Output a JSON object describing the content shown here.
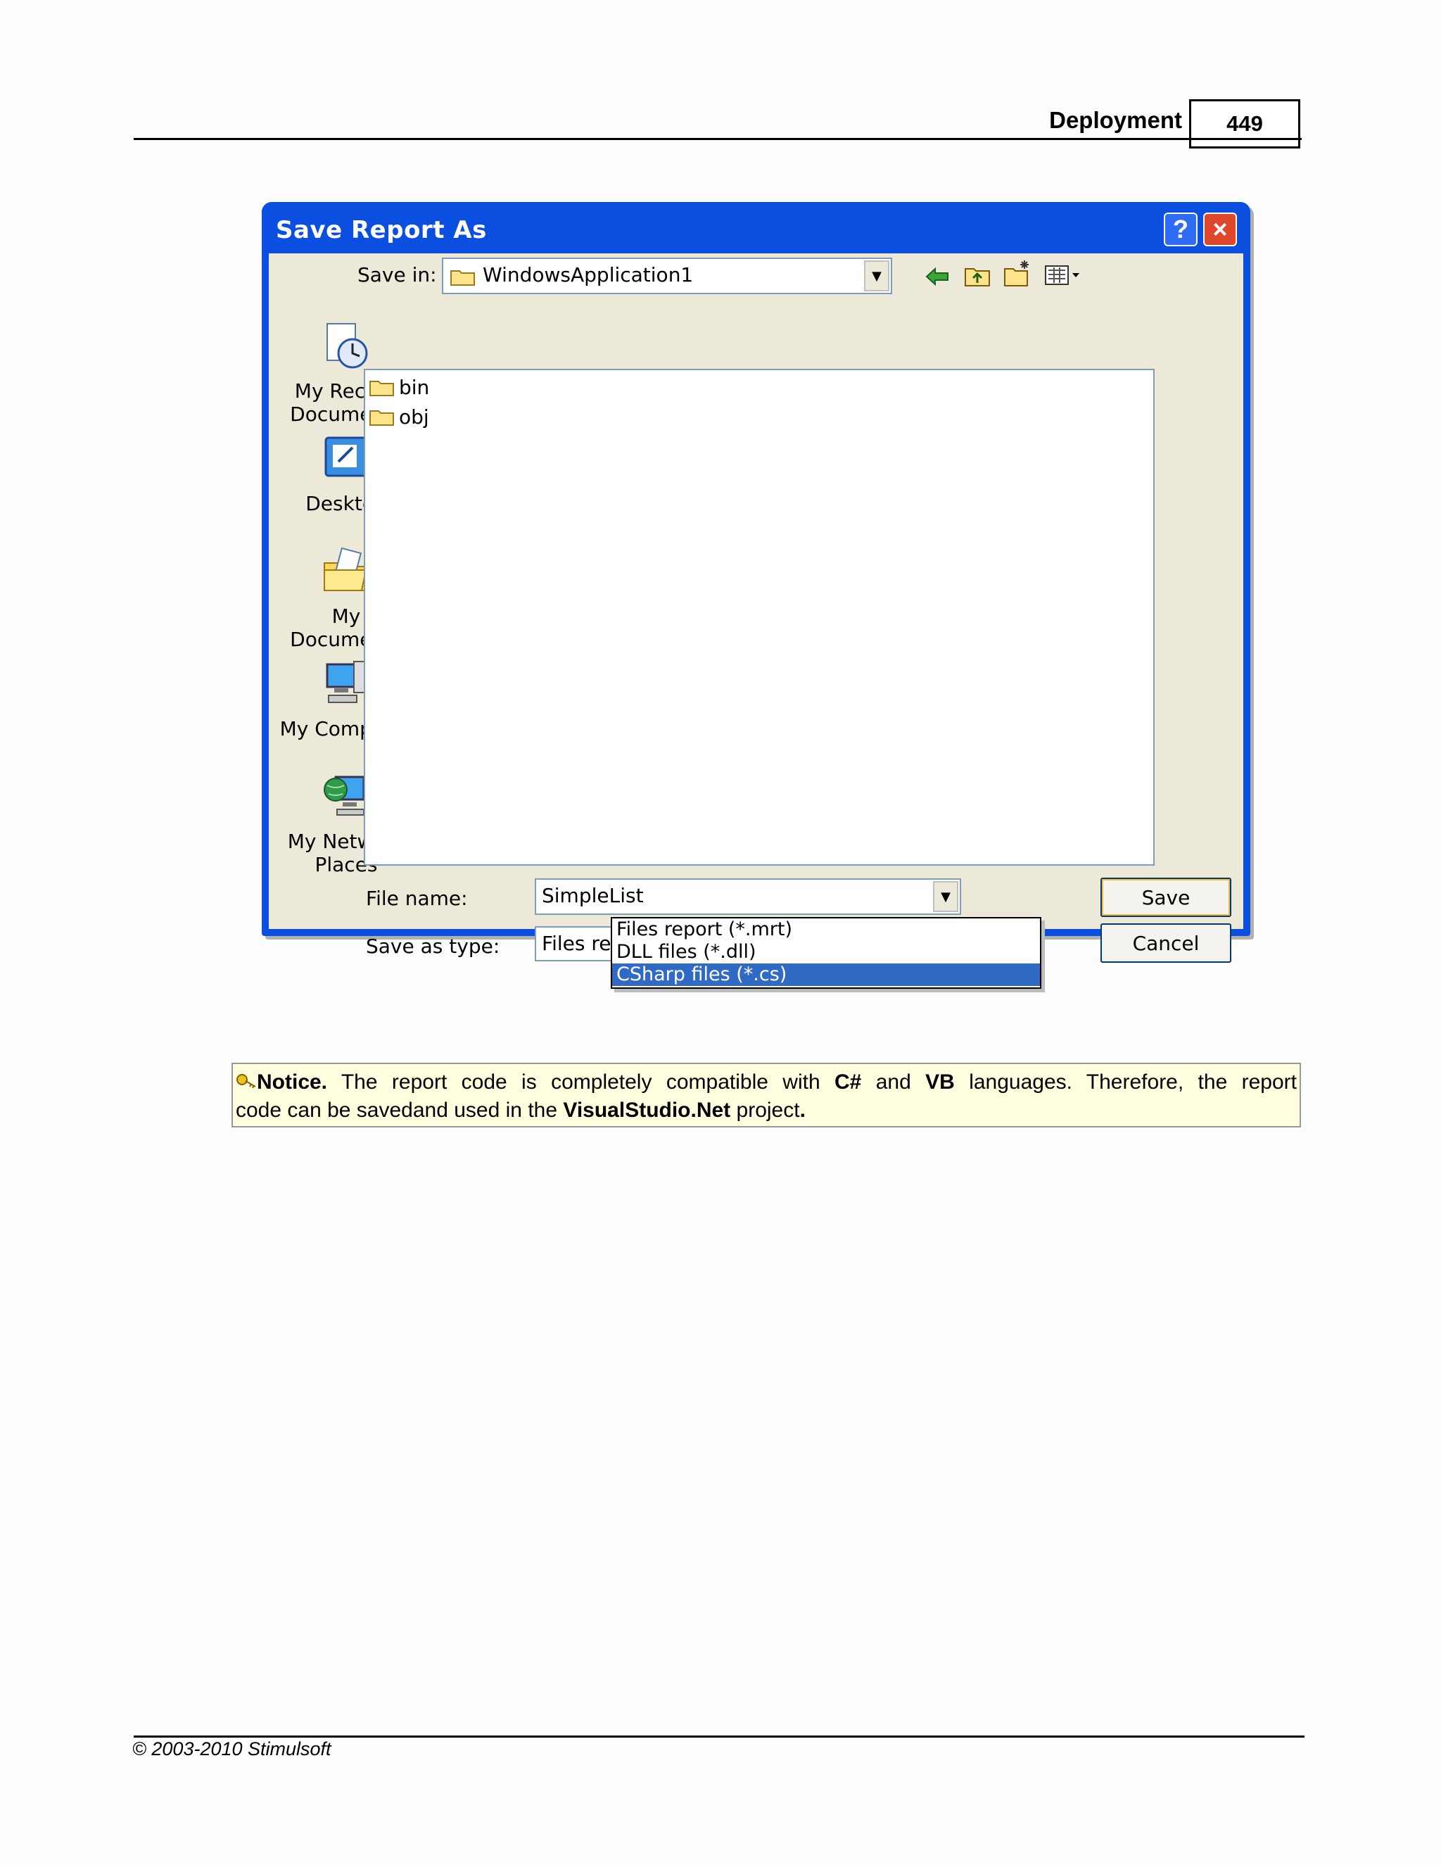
{
  "page_header": {
    "section": "Deployment",
    "page_number": "449"
  },
  "dialog": {
    "title": "Save Report As",
    "help_label": "?",
    "close_label": "×",
    "save_in_label": "Save in:",
    "save_in_value": "WindowsApplication1",
    "places": [
      {
        "label1": "My Recent",
        "label2": "Documents",
        "icon": "recent-documents-icon"
      },
      {
        "label1": "Desktop",
        "label2": "",
        "icon": "desktop-icon"
      },
      {
        "label1": "My Documents",
        "label2": "",
        "icon": "my-documents-icon"
      },
      {
        "label1": "My Computer",
        "label2": "",
        "icon": "my-computer-icon"
      },
      {
        "label1": "My Network",
        "label2": "Places",
        "icon": "network-places-icon"
      }
    ],
    "files": [
      "bin",
      "obj"
    ],
    "file_name_label": "File name:",
    "file_name_value": "SimpleList",
    "save_as_type_label": "Save as type:",
    "save_as_type_value": "Files report (*.mrt)",
    "save_button": "Save",
    "cancel_button": "Cancel",
    "type_options": [
      "Files report (*.mrt)",
      "DLL files (*.dll)",
      "CSharp files (*.cs)"
    ],
    "selected_option_index": 2,
    "colors": {
      "title_bar": "#0a4fe0",
      "body": "#ece9d8",
      "selection": "#316ac5"
    }
  },
  "notice": {
    "lead": "Notice.",
    "t1": " The report code is completely compatible with ",
    "b1": "C#",
    "t2": " and ",
    "b2": "VB",
    "t3": " languages. Therefore, the report",
    "t4": "code can be savedand used in the ",
    "b3": "VisualStudio.Net",
    "t5": " project",
    "end": "."
  },
  "footer": {
    "text": "© 2003-2010 Stimulsoft"
  }
}
